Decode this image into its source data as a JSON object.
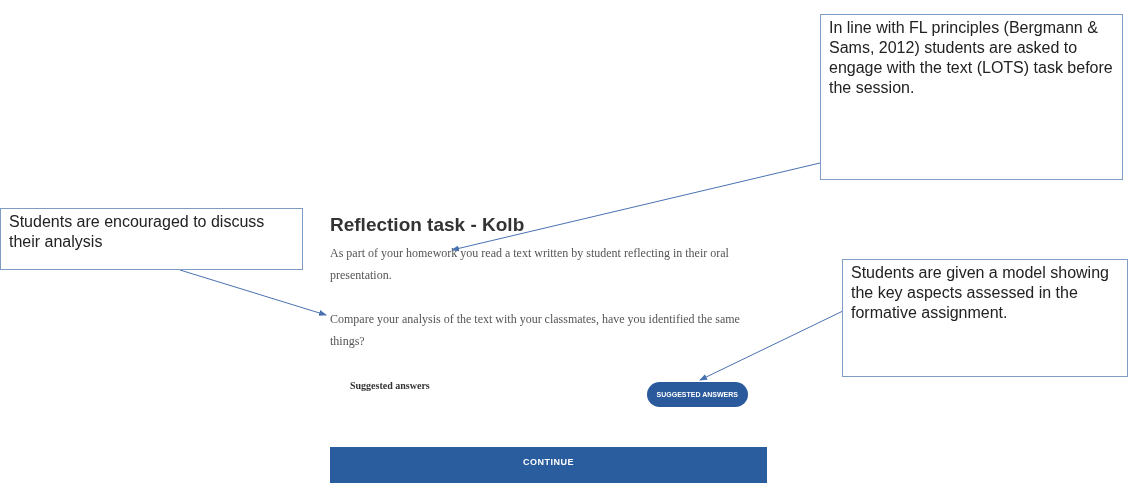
{
  "lesson": {
    "title": "Reflection task - Kolb",
    "paragraphs": [
      "As part of your homework you read a text written by student reflecting in their oral presentation.",
      "Compare your analysis of the text with your classmates, have you identified the same things?"
    ],
    "answers_label": "Suggested answers",
    "answers_button": "SUGGESTED ANSWERS",
    "continue_button": "CONTINUE"
  },
  "callouts": [
    {
      "text": "In line with FL principles (Bergmann & Sams, 2012) students are asked to engage with the text (LOTS) task before the session."
    },
    {
      "text": "Students are encouraged to discuss their analysis"
    },
    {
      "text": "Students are given a model showing the key aspects assessed in the formative assignment."
    }
  ]
}
